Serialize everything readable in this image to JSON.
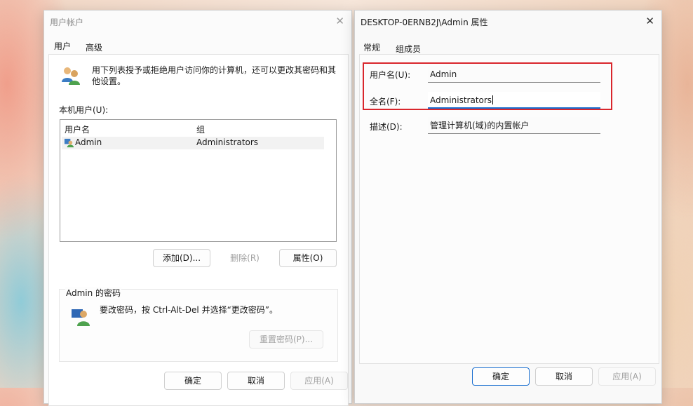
{
  "user_accounts": {
    "title": "用户帐户",
    "tabs": [
      "用户",
      "高级"
    ],
    "intro": "用下列表授予或拒绝用户访问你的计算机，还可以更改其密码和其他设置。",
    "users_label": "本机用户(U):",
    "columns": [
      "用户名",
      "组"
    ],
    "rows": [
      {
        "name": "Admin",
        "group": "Administrators"
      }
    ],
    "buttons": {
      "add": "添加(D)...",
      "remove": "删除(R)",
      "properties": "属性(O)"
    },
    "password_group": "Admin 的密码",
    "password_text": "要改密码，按 Ctrl-Alt-Del 并选择“更改密码”。",
    "reset_password": "重置密码(P)...",
    "footer": {
      "ok": "确定",
      "cancel": "取消",
      "apply": "应用(A)"
    }
  },
  "properties": {
    "title": "DESKTOP-0ERNB2J\\Admin 属性",
    "tabs": [
      "常规",
      "组成员"
    ],
    "username_label": "用户名(U):",
    "username_value": "Admin",
    "fullname_label": "全名(F):",
    "fullname_value": "Administrators",
    "description_label": "描述(D):",
    "description_value": "管理计算机(域)的内置帐户",
    "footer": {
      "ok": "确定",
      "cancel": "取消",
      "apply": "应用(A)"
    }
  },
  "icons": {
    "close": "close-icon",
    "users": "users-icon",
    "user_row": "user-icon",
    "password_user": "user-key-icon"
  },
  "colors": {
    "accent": "#1a6fd0",
    "highlight": "#d9262c"
  }
}
